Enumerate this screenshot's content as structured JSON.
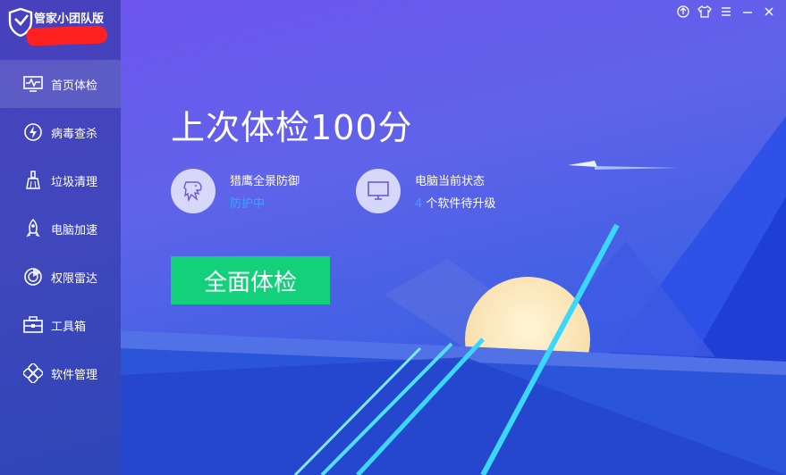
{
  "brand": {
    "title": "管家小团队版"
  },
  "window_controls": [
    "upload-icon",
    "skin-icon",
    "menu-icon",
    "minimize-icon",
    "close-icon"
  ],
  "sidebar": {
    "items": [
      {
        "label": "首页体检",
        "icon": "monitor-pulse-icon",
        "active": true
      },
      {
        "label": "病毒查杀",
        "icon": "lightning-shield-icon",
        "active": false
      },
      {
        "label": "垃圾清理",
        "icon": "broom-icon",
        "active": false
      },
      {
        "label": "电脑加速",
        "icon": "rocket-icon",
        "active": false
      },
      {
        "label": "权限雷达",
        "icon": "radar-icon",
        "active": false
      },
      {
        "label": "工具箱",
        "icon": "toolbox-icon",
        "active": false
      },
      {
        "label": "软件管理",
        "icon": "apps-icon",
        "active": false
      }
    ]
  },
  "main": {
    "headline": "上次体检100分",
    "protection": {
      "title": "猎鹰全景防御",
      "status": "防护中"
    },
    "pc_status": {
      "title": "电脑当前状态",
      "count": "4",
      "suffix": "个软件待升级"
    },
    "scan_button": "全面体检"
  },
  "colors": {
    "accent_green": "#13d17a",
    "status_blue": "#36a6ff",
    "bg_top": "#6b4ff0",
    "bg_bottom": "#1a3fc8"
  }
}
